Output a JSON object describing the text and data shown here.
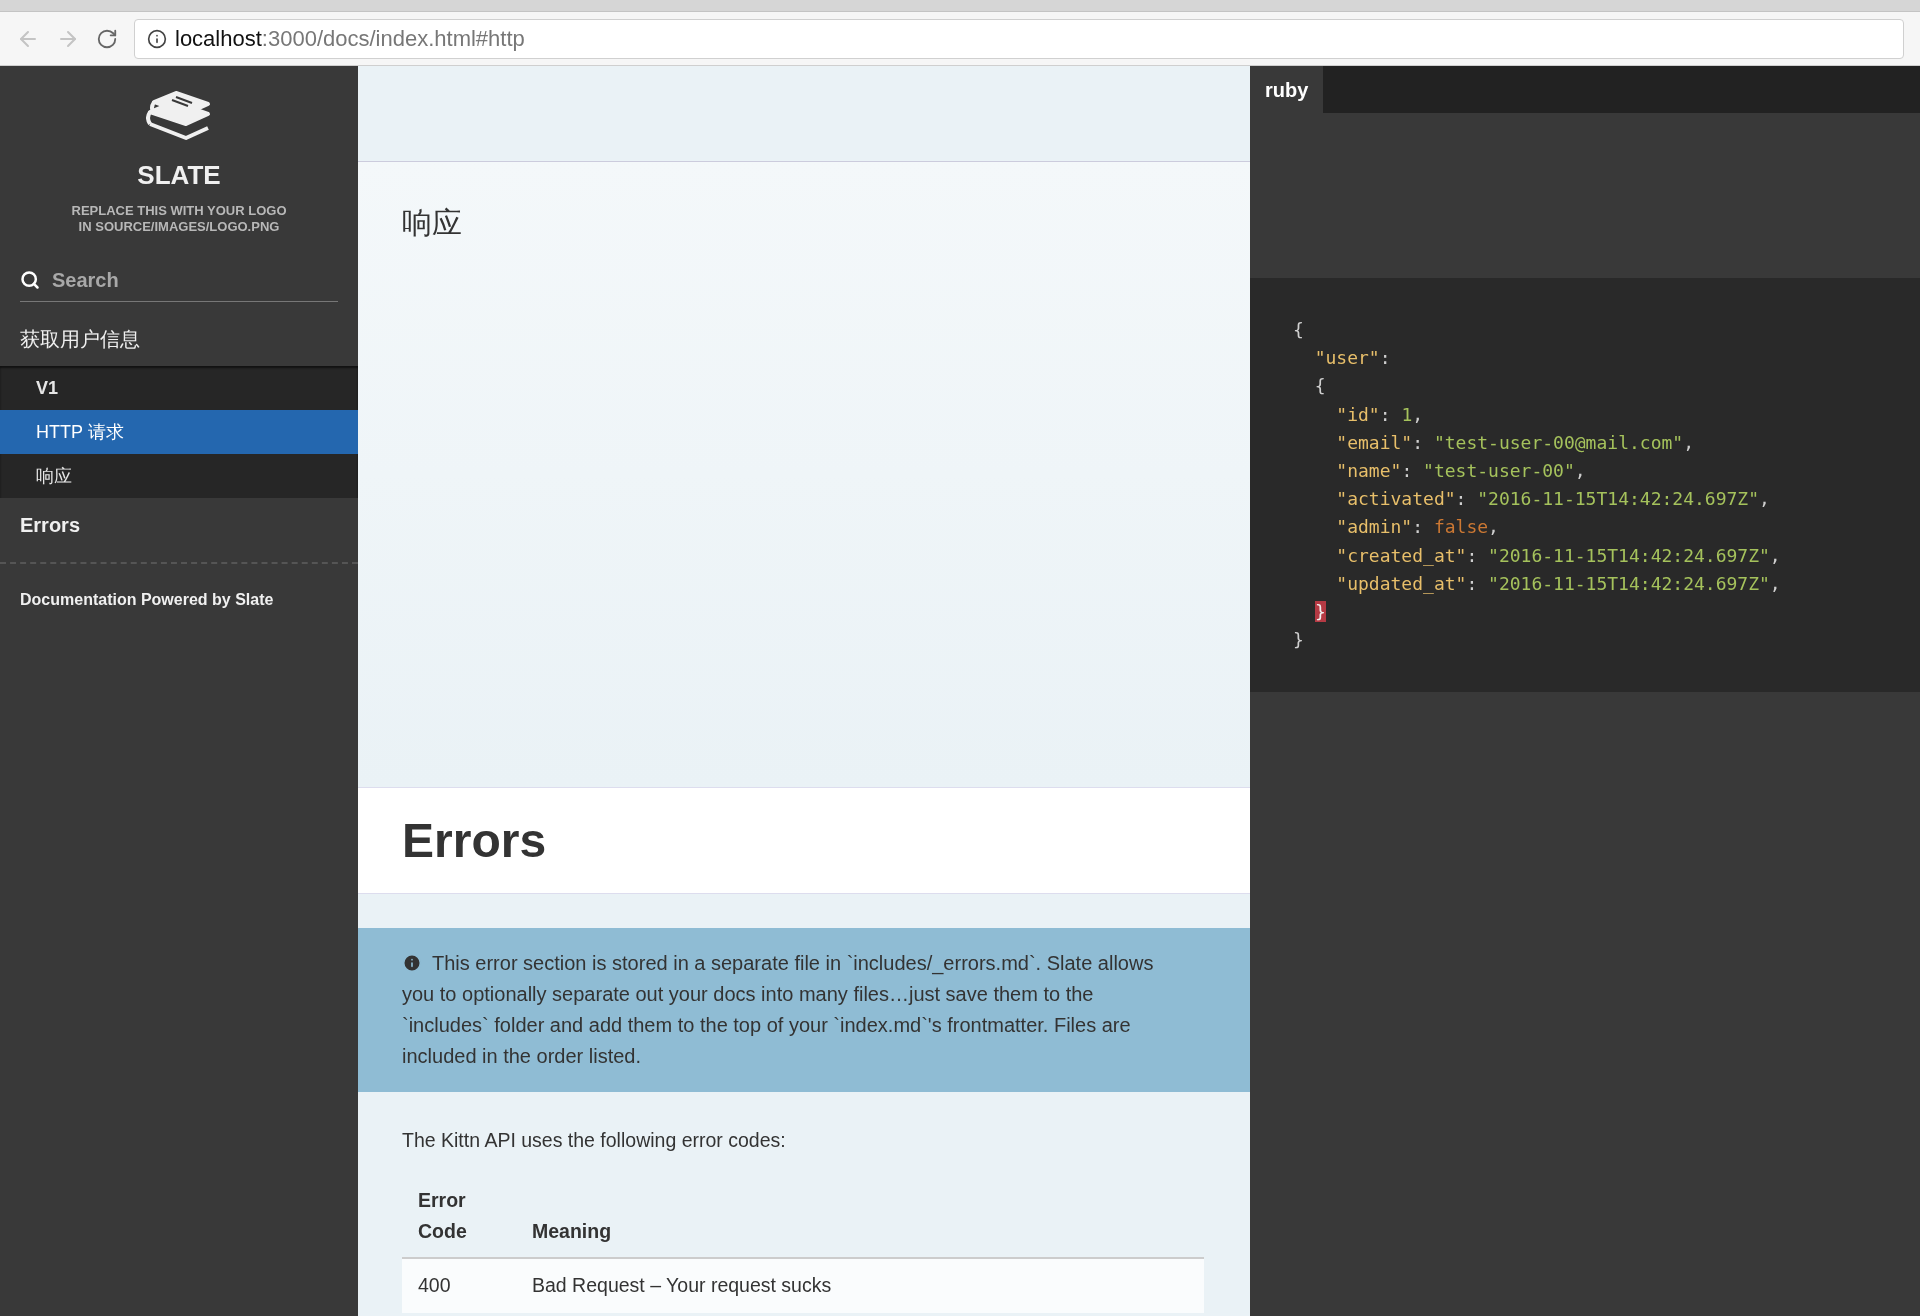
{
  "browser": {
    "url_host": "localhost",
    "url_path": ":3000/docs/index.html#http"
  },
  "sidebar": {
    "logo_title": "SLATE",
    "logo_subtitle": "REPLACE THIS WITH YOUR LOGO\nIN SOURCE/IMAGES/LOGO.PNG",
    "search": {
      "placeholder": "Search"
    },
    "items": [
      {
        "label": "获取用户信息",
        "selected": false,
        "children": [
          {
            "label": "V1",
            "selected": false,
            "bold": true
          },
          {
            "label": "HTTP 请求",
            "selected": true,
            "bold": false
          },
          {
            "label": "响应",
            "selected": false,
            "bold": false
          }
        ]
      },
      {
        "label": "Errors",
        "selected": false,
        "bold": true
      }
    ],
    "footer": "Documentation Powered by Slate"
  },
  "main": {
    "section_heading": "响应",
    "errors_heading": "Errors",
    "aside": "This error section is stored in a separate file in `includes/_errors.md`. Slate allows you to optionally separate out your docs into many files…just save them to the `includes` folder and add them to the top of your `index.md`'s frontmatter. Files are included in the order listed.",
    "intro": "The Kittn API uses the following error codes:",
    "table": {
      "columns": [
        "Error Code",
        "Meaning"
      ],
      "rows": [
        [
          "400",
          "Bad Request – Your request sucks"
        ]
      ]
    }
  },
  "code_panel": {
    "tabs": [
      {
        "label": "ruby",
        "selected": true
      }
    ],
    "lines": [
      [
        {
          "kind": "punct",
          "text": "{"
        }
      ],
      [
        {
          "kind": "key",
          "text": "  \"user\""
        },
        {
          "kind": "punct",
          "text": ":"
        }
      ],
      [
        {
          "kind": "punct",
          "text": "  {"
        }
      ],
      [
        {
          "kind": "key",
          "text": "    \"id\""
        },
        {
          "kind": "punct",
          "text": ": "
        },
        {
          "kind": "number",
          "text": "1"
        },
        {
          "kind": "punct",
          "text": ","
        }
      ],
      [
        {
          "kind": "key",
          "text": "    \"email\""
        },
        {
          "kind": "punct",
          "text": ": "
        },
        {
          "kind": "string",
          "text": "\"test-user-00@mail.com\""
        },
        {
          "kind": "punct",
          "text": ","
        }
      ],
      [
        {
          "kind": "key",
          "text": "    \"name\""
        },
        {
          "kind": "punct",
          "text": ": "
        },
        {
          "kind": "string",
          "text": "\"test-user-00\""
        },
        {
          "kind": "punct",
          "text": ","
        }
      ],
      [
        {
          "kind": "key",
          "text": "    \"activated\""
        },
        {
          "kind": "punct",
          "text": ": "
        },
        {
          "kind": "string",
          "text": "\"2016-11-15T14:42:24.697Z\""
        },
        {
          "kind": "punct",
          "text": ","
        }
      ],
      [
        {
          "kind": "key",
          "text": "    \"admin\""
        },
        {
          "kind": "punct",
          "text": ": "
        },
        {
          "kind": "keyword",
          "text": "false"
        },
        {
          "kind": "punct",
          "text": ","
        }
      ],
      [
        {
          "kind": "key",
          "text": "    \"created_at\""
        },
        {
          "kind": "punct",
          "text": ": "
        },
        {
          "kind": "string",
          "text": "\"2016-11-15T14:42:24.697Z\""
        },
        {
          "kind": "punct",
          "text": ","
        }
      ],
      [
        {
          "kind": "key",
          "text": "    \"updated_at\""
        },
        {
          "kind": "punct",
          "text": ": "
        },
        {
          "kind": "string",
          "text": "\"2016-11-15T14:42:24.697Z\""
        },
        {
          "kind": "punct",
          "text": ","
        }
      ],
      [
        {
          "kind": "error",
          "text": "}"
        }
      ],
      [
        {
          "kind": "punct",
          "text": "}"
        }
      ]
    ]
  }
}
